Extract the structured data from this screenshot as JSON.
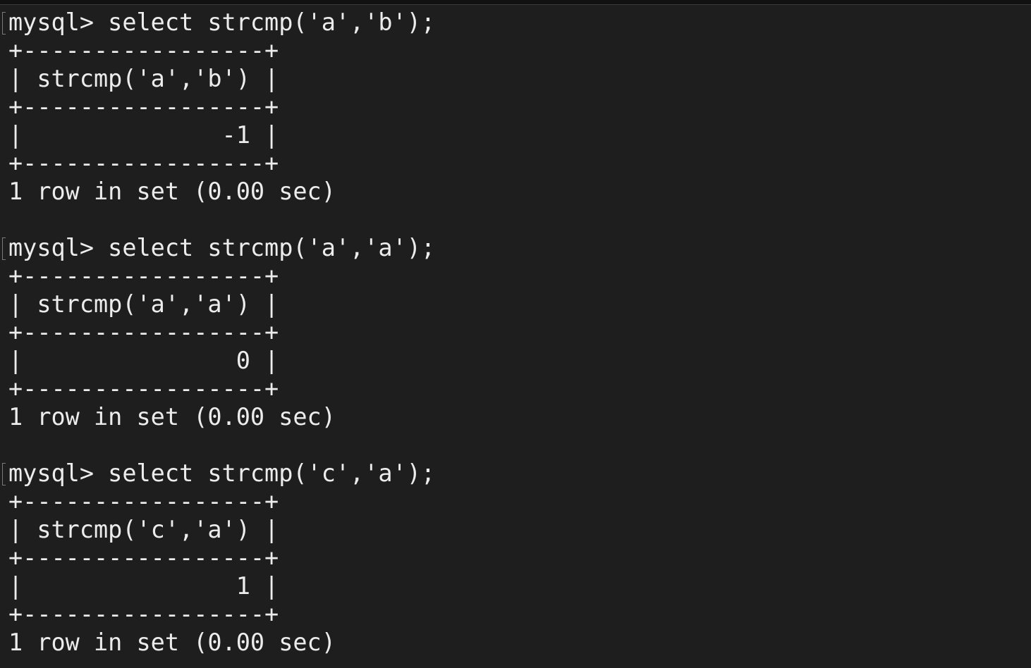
{
  "terminal": {
    "blocks": [
      {
        "prompt": "mysql> select strcmp('a','b');",
        "border_top": "+-----------------+",
        "header": "| strcmp('a','b') |",
        "border_mid": "+-----------------+",
        "row": "|              -1 |",
        "border_bottom": "+-----------------+",
        "footer": "1 row in set (0.00 sec)"
      },
      {
        "prompt": "mysql> select strcmp('a','a');",
        "border_top": "+-----------------+",
        "header": "| strcmp('a','a') |",
        "border_mid": "+-----------------+",
        "row": "|               0 |",
        "border_bottom": "+-----------------+",
        "footer": "1 row in set (0.00 sec)"
      },
      {
        "prompt": "mysql> select strcmp('c','a');",
        "border_top": "+-----------------+",
        "header": "| strcmp('c','a') |",
        "border_mid": "+-----------------+",
        "row": "|               1 |",
        "border_bottom": "+-----------------+",
        "footer": "1 row in set (0.00 sec)"
      }
    ]
  }
}
